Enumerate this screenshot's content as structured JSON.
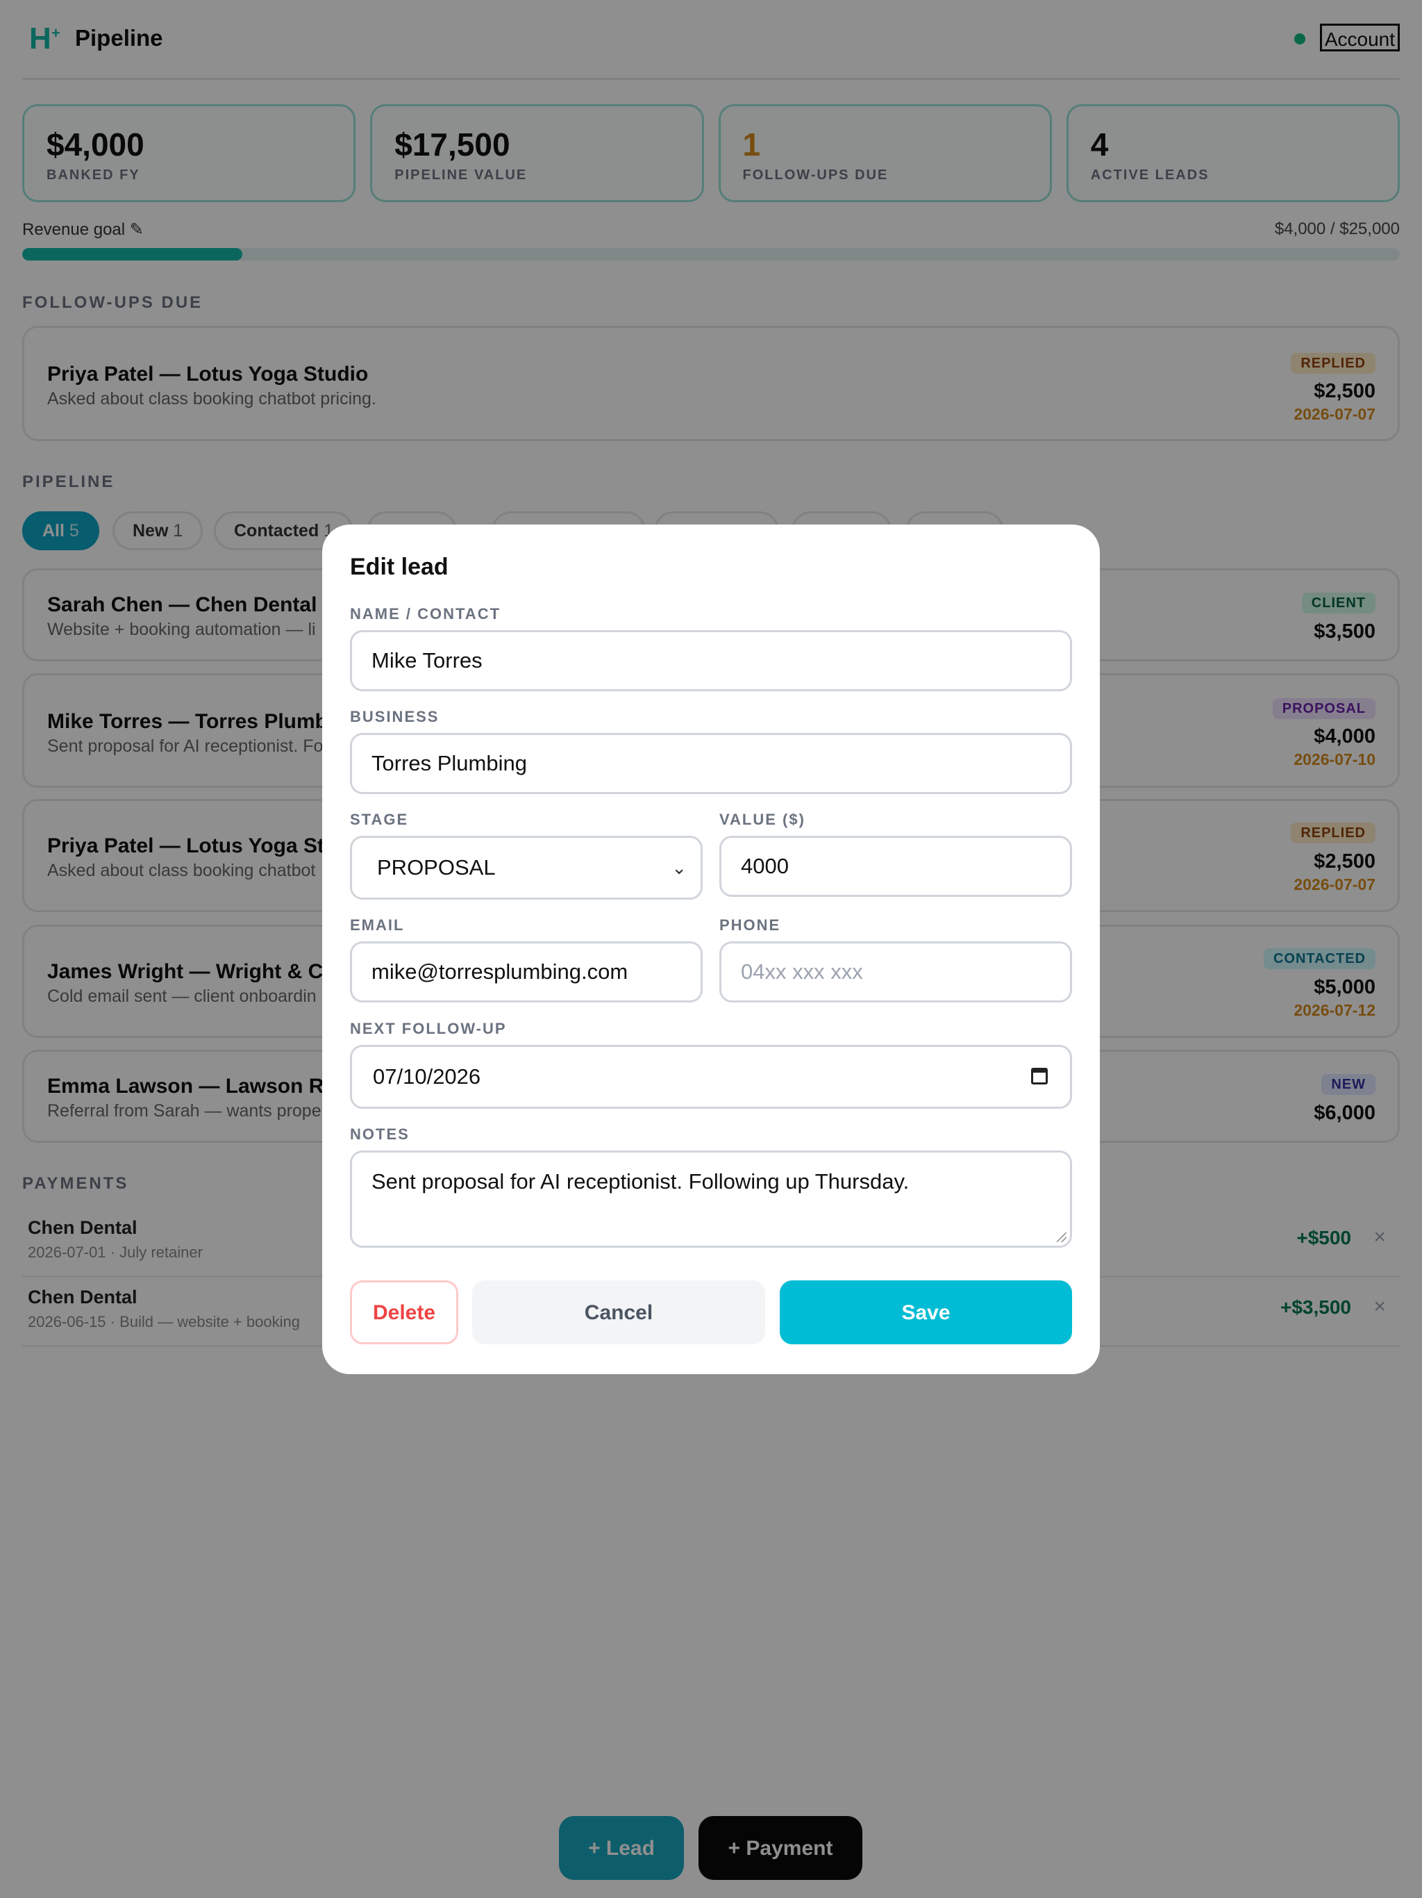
{
  "header": {
    "logo_text": "H",
    "logo_mark": "+",
    "title": "Pipeline",
    "account_label": "Account"
  },
  "stats": [
    {
      "value": "$4,000",
      "label": "BANKED FY",
      "color": "#111111"
    },
    {
      "value": "$17,500",
      "label": "PIPELINE VALUE",
      "color": "#111111"
    },
    {
      "value": "1",
      "label": "FOLLOW-UPS DUE",
      "color": "#d4891c"
    },
    {
      "value": "4",
      "label": "ACTIVE LEADS",
      "color": "#111111"
    }
  ],
  "goal": {
    "label": "Revenue goal ✎",
    "amount": "$4,000 / $25,000",
    "progress": 0.16
  },
  "followups": {
    "title": "FOLLOW-UPS DUE",
    "items": [
      {
        "title": "Priya Patel — Lotus Yoga Studio",
        "subtitle": "Asked about class booking chatbot pricing.",
        "badge": "REPLIED",
        "value": "$2,500",
        "date": "2026-07-07"
      }
    ]
  },
  "pipeline": {
    "title": "PIPELINE",
    "filters": [
      {
        "label": "All",
        "count": "5"
      },
      {
        "label": "New",
        "count": "1"
      },
      {
        "label": "Contacted",
        "count": "1"
      }
    ],
    "leads": [
      {
        "title": "Sarah Chen — Chen Dental",
        "subtitle": "Website + booking automation — li",
        "badge": "CLIENT",
        "value": "$3,500",
        "date": ""
      },
      {
        "title": "Mike Torres — Torres Plumbi",
        "subtitle": "Sent proposal for AI receptionist. Fo",
        "badge": "PROPOSAL",
        "value": "$4,000",
        "date": "2026-07-10"
      },
      {
        "title": "Priya Patel — Lotus Yoga Stuc",
        "subtitle": "Asked about class booking chatbot",
        "badge": "REPLIED",
        "value": "$2,500",
        "date": "2026-07-07"
      },
      {
        "title": "James Wright — Wright & Co",
        "subtitle": "Cold email sent — client onboardin",
        "badge": "CONTACTED",
        "value": "$5,000",
        "date": "2026-07-12"
      },
      {
        "title": "Emma Lawson — Lawson Rea",
        "subtitle": "Referral from Sarah — wants prope",
        "badge": "NEW",
        "value": "$6,000",
        "date": ""
      }
    ]
  },
  "payments": {
    "title": "PAYMENTS",
    "items": [
      {
        "client": "Chen Dental",
        "meta": "2026-07-01 · July retainer",
        "amount": "+$500",
        "delete_glyph": "×"
      },
      {
        "client": "Chen Dental",
        "meta": "2026-06-15 · Build — website + booking",
        "amount": "+$3,500",
        "delete_glyph": "×"
      }
    ]
  },
  "fab": {
    "lead_label": "+ Lead",
    "payment_label": "+ Payment"
  },
  "modal": {
    "title": "Edit lead",
    "name_label": "NAME / CONTACT",
    "name_value": "Mike Torres",
    "business_label": "BUSINESS",
    "business_value": "Torres Plumbing",
    "stage_label": "STAGE",
    "stage_value": "PROPOSAL",
    "value_label": "VALUE ($)",
    "value_value": "4000",
    "email_label": "EMAIL",
    "email_value": "mike@torresplumbing.com",
    "phone_label": "PHONE",
    "phone_placeholder": "04xx xxx xxx",
    "followup_label": "NEXT FOLLOW-UP",
    "followup_value": "07/10/2026",
    "notes_label": "NOTES",
    "notes_value": "Sent proposal for AI receptionist. Following up Thursday.",
    "delete_label": "Delete",
    "cancel_label": "Cancel",
    "save_label": "Save"
  },
  "icons": {
    "logo": "logo-icon",
    "status": "status-dot-icon",
    "chevron": "chevron-down-icon",
    "calendar": "calendar-icon",
    "close": "close-icon"
  },
  "colors": {
    "accent": "#00bcd4",
    "teal": "#14b8a6",
    "followup": "#d4891c",
    "danger": "#ef4444",
    "payment": "#047857"
  }
}
